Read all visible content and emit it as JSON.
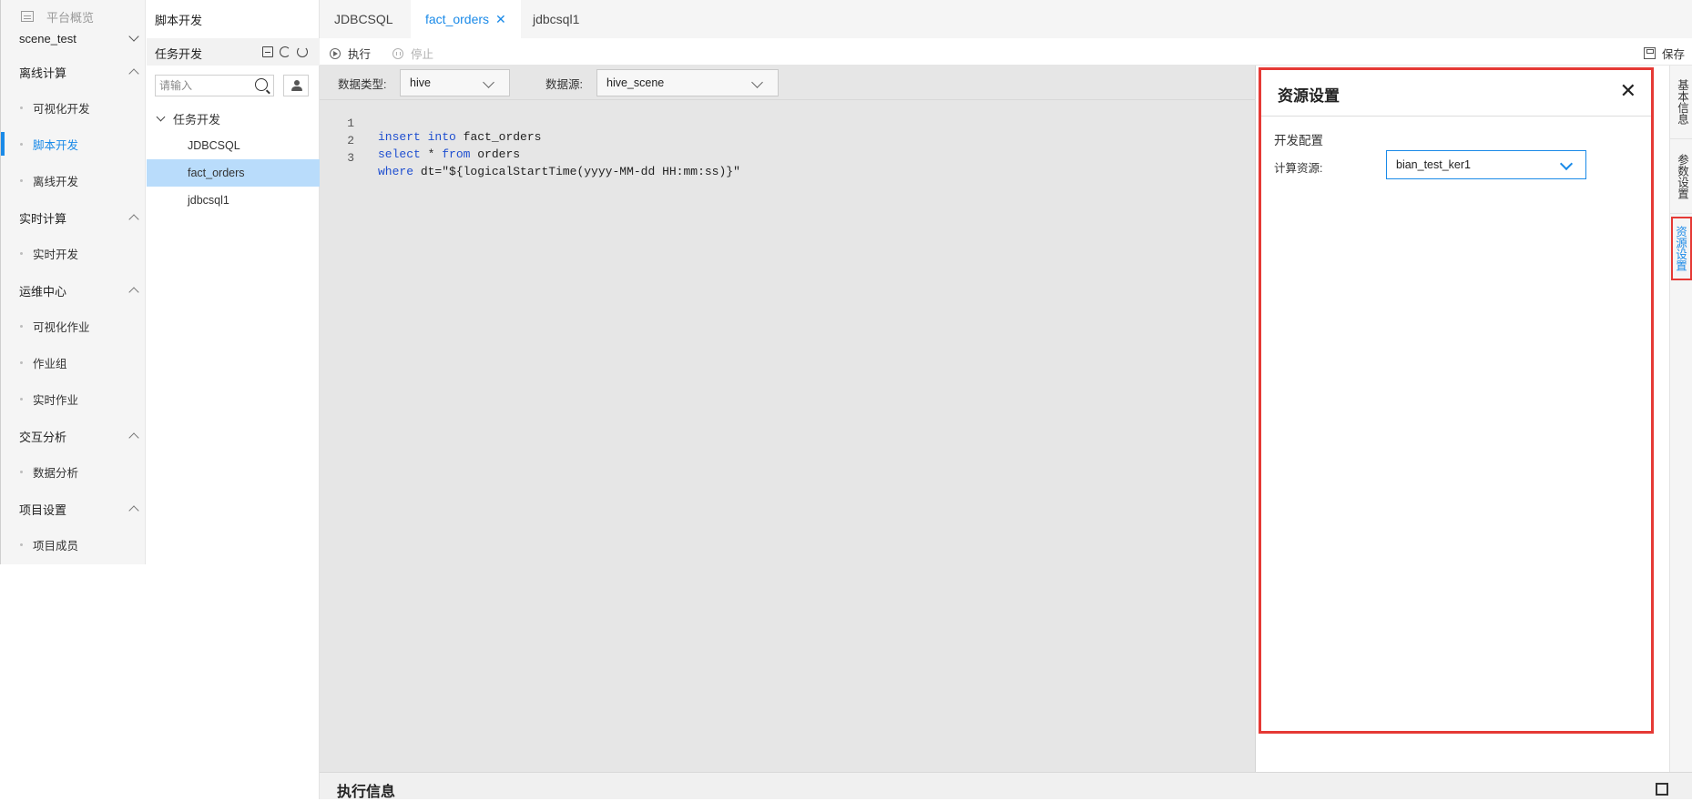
{
  "nav": {
    "overview": "平台概览",
    "project": "scene_test",
    "groups": [
      {
        "title": "离线计算",
        "items": [
          "可视化开发",
          "脚本开发",
          "离线开发"
        ]
      },
      {
        "title": "实时计算",
        "items": [
          "实时开发"
        ]
      },
      {
        "title": "运维中心",
        "items": [
          "可视化作业",
          "作业组",
          "实时作业"
        ]
      },
      {
        "title": "交互分析",
        "items": [
          "数据分析"
        ]
      },
      {
        "title": "项目设置",
        "items": [
          "项目成员"
        ]
      }
    ],
    "active_item": "脚本开发"
  },
  "tree": {
    "title": "脚本开发",
    "bar_label": "任务开发",
    "search_placeholder": "请输入",
    "folder": "任务开发",
    "nodes": [
      "JDBCSQL",
      "fact_orders",
      "jdbcsql1"
    ],
    "selected": "fact_orders"
  },
  "tabs": [
    "JDBCSQL",
    "fact_orders",
    "jdbcsql1"
  ],
  "toolbar": {
    "run": "执行",
    "stop": "停止",
    "save": "保存"
  },
  "editor": {
    "data_type_label": "数据类型:",
    "data_type_value": "hive",
    "data_source_label": "数据源:",
    "data_source_value": "hive_scene",
    "lines": [
      {
        "num": "1",
        "text": "insert into fact_orders"
      },
      {
        "num": "2",
        "text": "select * from orders"
      },
      {
        "num": "3",
        "text": "where dt=\"${logicalStartTime(yyyy-MM-dd HH:mm:ss)}\""
      }
    ]
  },
  "resource_panel": {
    "title": "资源设置",
    "close": "✕",
    "section": "开发配置",
    "compute_label": "计算资源:",
    "compute_value": "bian_test_ker1"
  },
  "side_tabs": [
    "基本信息",
    "参数设置",
    "资源设置"
  ],
  "bottom": {
    "title": "执行信息"
  },
  "colors": {
    "accent": "#1a8ae8",
    "highlight": "#e53935",
    "selected_row": "#b9dcfb"
  }
}
